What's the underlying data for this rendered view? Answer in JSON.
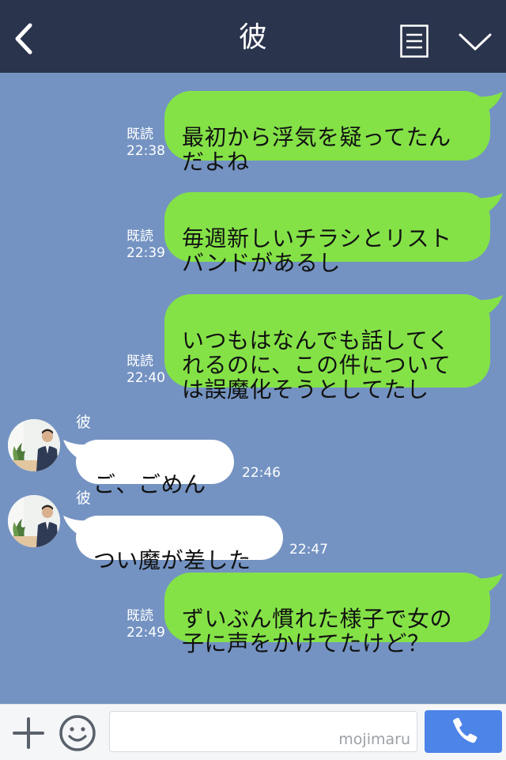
{
  "header": {
    "title": "彼"
  },
  "messages": [
    {
      "text": "最初から浮気を疑ってたん\nだよね",
      "read": "既読",
      "time": "22:38"
    },
    {
      "text": "毎週新しいチラシとリスト\nバンドがあるし",
      "read": "既読",
      "time": "22:39"
    },
    {
      "text": "いつもはなんでも話してく\nれるのに、この件について\nは誤魔化そうとしてたし",
      "read": "既読",
      "time": "22:40"
    },
    {
      "sender": "彼",
      "text": "ご、ごめん",
      "time": "22:46"
    },
    {
      "sender": "彼",
      "text": "つい魔が差した",
      "time": "22:47"
    },
    {
      "text": "ずいぶん慣れた様子で女の\n子に声をかけてたけど？",
      "read": "既読",
      "time": "22:49"
    }
  ],
  "input": {
    "watermark": "mojimaru"
  },
  "colors": {
    "header": "#2a344d",
    "chat_bg": "#7493c2",
    "out_bubble": "#84e247",
    "in_bubble": "#ffffff",
    "call_button": "#4d84e8"
  },
  "icons": [
    "back-icon",
    "notes-icon",
    "chevron-down-icon",
    "plus-icon",
    "emoji-icon",
    "phone-icon"
  ]
}
